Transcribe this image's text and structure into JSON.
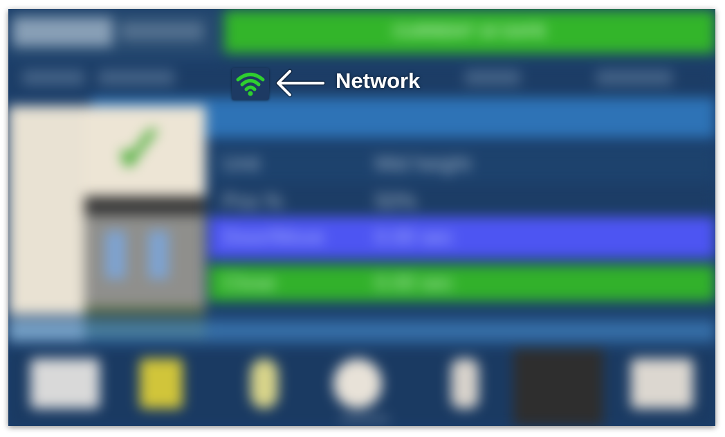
{
  "status_bar": {
    "text": "CURRENT 10 SAFE"
  },
  "details": [
    {
      "key": "Unit",
      "value": "Mid height"
    },
    {
      "key": "Pos %",
      "value": "50%"
    },
    {
      "key": "Door/Move",
      "value": "0.00 sec"
    },
    {
      "key": "Close",
      "value": "0.00 sec"
    }
  ],
  "annotation": {
    "label": "Network",
    "icon": "wifi-icon",
    "arrow": "left-arrow-icon"
  },
  "colors": {
    "background": "#1b3f6c",
    "status_green": "#33b52a",
    "highlight_blue": "#4d55f2",
    "wifi_green": "#2fcf2f"
  }
}
